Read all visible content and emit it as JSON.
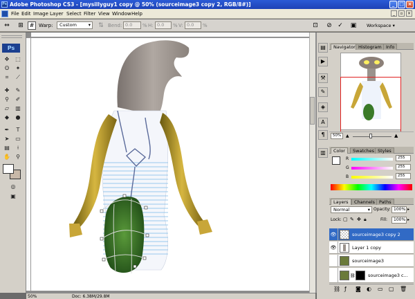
{
  "titlebar": {
    "title": "Adobe Photoshop CS3 - [mysillyguy1 copy @ 50% (sourceimage3 copy 2, RGB/8#)]"
  },
  "menubar": {
    "items": [
      "File",
      "Edit",
      "Image",
      "Layer",
      "Select",
      "Filter",
      "View",
      "Window",
      "Help"
    ]
  },
  "options": {
    "warp_label": "Warp:",
    "warp_value": "Custom",
    "bend_label": "Bend:",
    "bend_value": "0.0",
    "bend_unit": "%",
    "h_label": "H:",
    "h_value": "0.0",
    "h_unit": "%",
    "v_label": "V:",
    "v_value": "0.0",
    "v_unit": "%",
    "workspace_label": "Workspace"
  },
  "toolbox": {
    "logo": "Ps"
  },
  "status": {
    "zoom": "50%",
    "doc": "Doc: 6.38M/29.8M"
  },
  "navigator": {
    "tabs": [
      "Navigator",
      "Histogram",
      "Info"
    ],
    "zoom": "50%"
  },
  "color": {
    "tabs": [
      "Color",
      "Swatches",
      "Styles"
    ],
    "channels": [
      {
        "name": "R",
        "value": "255"
      },
      {
        "name": "G",
        "value": "255"
      },
      {
        "name": "B",
        "value": "255"
      }
    ]
  },
  "layers": {
    "tabs": [
      "Layers",
      "Channels",
      "Paths"
    ],
    "blend_mode": "Normal",
    "opacity_label": "Opacity:",
    "opacity": "100%",
    "lock_label": "Lock:",
    "fill_label": "Fill:",
    "fill": "100%",
    "items": [
      {
        "name": "sourceimage3 copy 2",
        "selected": true,
        "visible": true
      },
      {
        "name": "Layer 1 copy",
        "selected": false,
        "visible": true
      },
      {
        "name": "sourceimage3",
        "selected": false,
        "visible": false
      },
      {
        "name": "sourceimage3 c...",
        "selected": false,
        "visible": false
      }
    ]
  }
}
